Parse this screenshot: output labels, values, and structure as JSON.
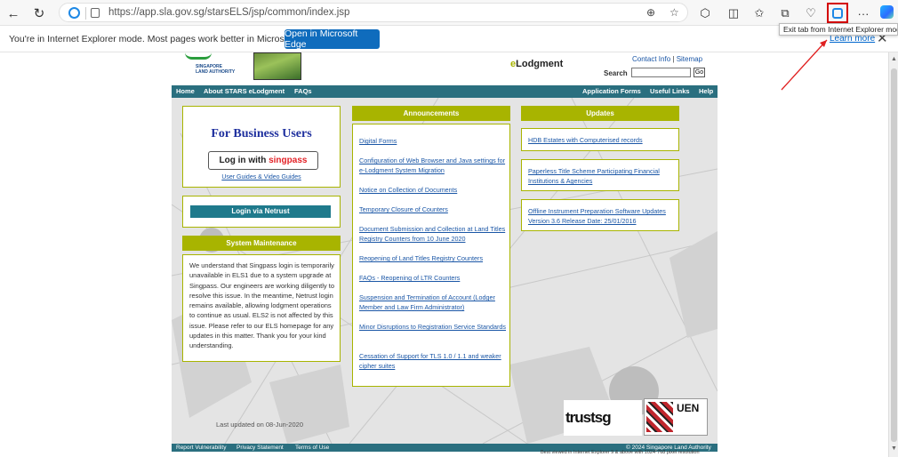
{
  "browser": {
    "url": "https://app.sla.gov.sg/starsELS/jsp/common/index.jsp",
    "tooltip": "Exit tab from Internet Explorer mode"
  },
  "infobar": {
    "message": "You're in Internet Explorer mode. Most pages work better in Microsoft Edge.",
    "open_button": "Open in Microsoft Edge",
    "learn_more": "Learn more"
  },
  "header": {
    "logo_line1": "SINGAPORE",
    "logo_line2": "LAND AUTHORITY",
    "elodgement_prefix": "e",
    "elodgement_rest": "Lodgment",
    "contact_info": "Contact Info",
    "sitemap": "Sitemap",
    "search_label": "Search",
    "go_label": "Go"
  },
  "nav": {
    "home": "Home",
    "about": "About STARS eLodgment",
    "faqs": "FAQs",
    "app_forms": "Application Forms",
    "useful_links": "Useful Links",
    "help": "Help"
  },
  "left": {
    "for_business": "For Business Users",
    "login_prefix": "Log in with ",
    "singpass": "singpass",
    "guides": "User Guides & Video Guides",
    "netrust": "Login via Netrust",
    "maintenance_title": "System Maintenance",
    "maintenance_text": "We understand that Singpass login is temporarily unavailable in ELS1 due to a system upgrade at Singpass. Our engineers are working diligently to resolve this issue. In the meantime, Netrust login remains available, allowing lodgment operations to continue as usual. ELS2 is not affected by this issue. Please refer to our ELS homepage for any updates in this matter. Thank you for your kind understanding."
  },
  "announcements": {
    "title": "Announcements",
    "items": [
      "Digital Forms",
      "Configuration of Web Browser and Java settings for e-Lodgment System Migration",
      "Notice on Collection of Documents",
      "Temporary Closure of Counters",
      "Document Submission and Collection at Land Titles Registry Counters from 10 June 2020",
      "Reopening of Land Titles Registry Counters",
      "FAQs - Reopening of LTR Counters",
      "Suspension and Termination of Account (Lodger Member and Law Firm Administrator)",
      "Minor Disruptions to Registration Service Standards",
      "Cessation of Support for TLS 1.0 / 1.1 and weaker cipher suites"
    ]
  },
  "updates": {
    "title": "Updates",
    "items": [
      "HDB Estates with Computerised records",
      "Paperless Title Scheme Participating Financial Institutions & Agencies",
      "Offline Instrument Preparation Software Updates Version 3.6 Release Date: 25/01/2016"
    ]
  },
  "last_updated": "Last updated on 08-Jun-2020",
  "badges": {
    "trust": "trustsg",
    "uen": "UEN"
  },
  "footer": {
    "report": "Report Vulnerability",
    "privacy": "Privacy Statement",
    "terms": "Terms of Use",
    "copyright": "© 2024 Singapore Land Authority",
    "best_viewed": "Best viewed in Internet Explorer 9 & above with 1024*768 pixel resolution"
  },
  "colors": {
    "nav_teal": "#2a6f7f",
    "olive": "#a8b400",
    "edge_blue": "#0f6cbd",
    "highlight_red": "#d40000"
  }
}
